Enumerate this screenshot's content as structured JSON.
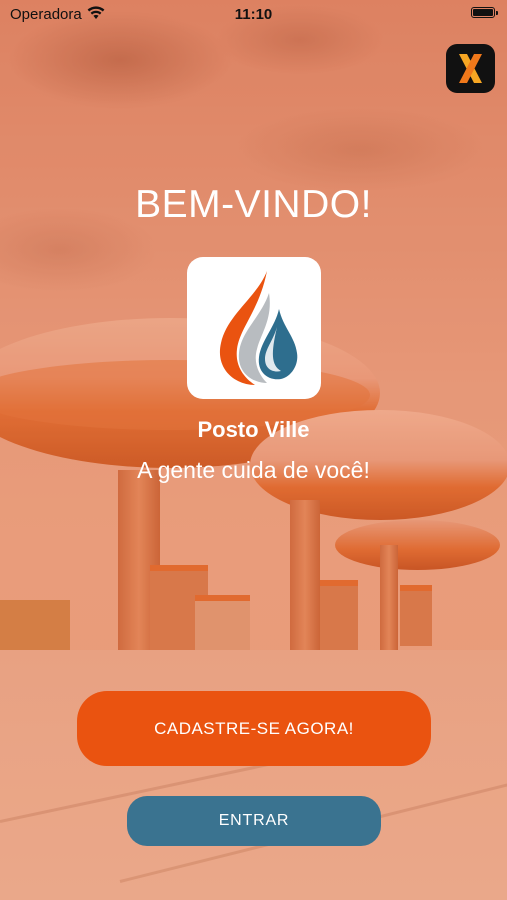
{
  "status_bar": {
    "carrier": "Operadora",
    "time": "11:10"
  },
  "corner_app": {
    "icon": "x-logo-icon",
    "label": "X"
  },
  "welcome": {
    "title": "BEM-VINDO!"
  },
  "brand": {
    "logo_icon": "water-drop-logo-icon",
    "name": "Posto Ville",
    "tagline": "A gente cuida de você!"
  },
  "actions": {
    "signup_label": "CADASTRE-SE AGORA!",
    "login_label": "ENTRAR"
  },
  "colors": {
    "accent_orange": "#ea5310",
    "button_blue": "#3a7390",
    "text_white": "#ffffff"
  }
}
